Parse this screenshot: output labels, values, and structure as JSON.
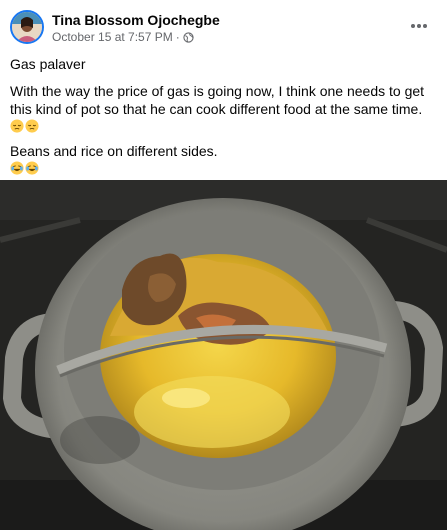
{
  "post": {
    "author": "Tina Blossom Ojochegbe",
    "timestamp": "October 15 at 7:57 PM",
    "separator": "·",
    "privacy_icon": "globe-icon",
    "more_icon": "more-options-icon",
    "paragraphs": [
      "Gas palaver",
      "With the way the price of gas is going now, I think one needs to get this kind of pot so that he can cook different food at the same time.",
      "Beans and rice on different sides."
    ],
    "emojis_1": [
      "face-with-closed-eyes-emoji",
      "face-with-closed-eyes-emoji"
    ],
    "emojis_2": [
      "laughing-tears-emoji",
      "laughing-tears-emoji"
    ]
  },
  "photo": {
    "subject": "divided-cooking-pot-photo"
  },
  "colors": {
    "accent": "#1877f2",
    "secondary_text": "#65676b",
    "emoji_yellow": "#ffcc4d"
  }
}
